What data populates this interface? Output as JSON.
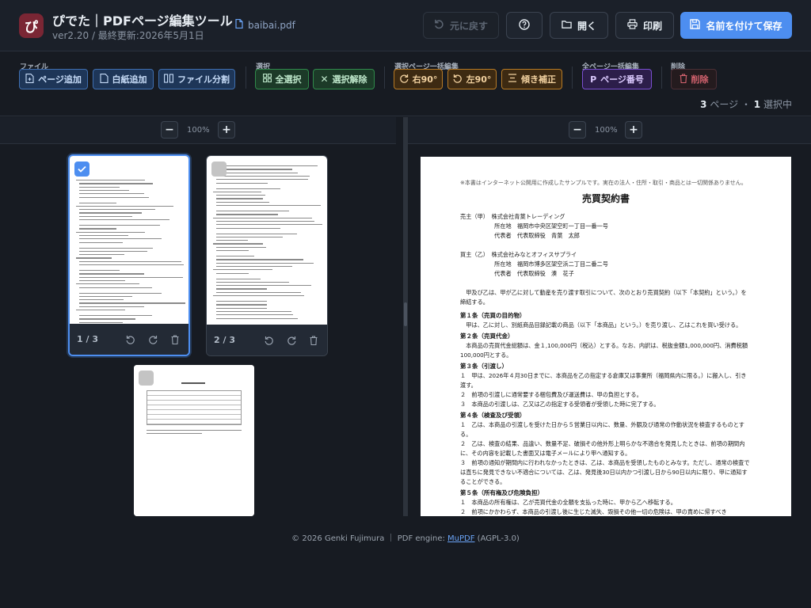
{
  "app": {
    "logo_char": "ぴ",
    "title": "ぴでた｜PDFページ編集ツール",
    "version": "ver2.20 / 最終更新:2026年5月1日",
    "file_name": "baibai.pdf"
  },
  "header_buttons": {
    "undo": "元に戻す",
    "help": "",
    "open": "開く",
    "print": "印刷",
    "save": "名前を付けて保存"
  },
  "toolbar": {
    "groups": {
      "file": "ファイル",
      "select": "選択",
      "sel_batch": "選択ページ一括編集",
      "all_batch": "全ページ一括編集",
      "delete": "削除"
    },
    "add_page": "ページ追加",
    "add_blank": "白紙追加",
    "split_file": "ファイル分割",
    "select_all": "全選択",
    "deselect": "選択解除",
    "rotate_right": "右90°",
    "rotate_left": "左90°",
    "deskew": "傾き補正",
    "page_number": "ページ番号",
    "delete": "削除"
  },
  "status": {
    "pages": "3",
    "pages_label": "ページ",
    "dot": "・",
    "selected": "1",
    "selected_label": "選択中"
  },
  "zoom": {
    "left": "100%",
    "right": "100%",
    "minus": "−",
    "plus": "+"
  },
  "thumbnails": [
    {
      "label": "1 / 3",
      "selected": true
    },
    {
      "label": "2 / 3",
      "selected": false
    },
    {
      "label": "3 / 3",
      "selected": false
    }
  ],
  "preview": {
    "note": "※本書はインターネット公開用に作成したサンプルです。実在の法人・住所・取引・商品とは一切関係ありません。",
    "title": "売買契約書",
    "seller": "売主（甲）　株式会社青葉トレーディング\n　　　　　　所在地　福岡市中央区架空町一丁目一番一号\n　　　　　　代表者　代表取締役　青葉　太郎",
    "buyer": "買主（乙）　株式会社みなとオフィスサプライ\n　　　　　　所在地　福岡市博多区架空浜二丁目二番二号\n　　　　　　代表者　代表取締役　湊　花子",
    "intro": "　甲及び乙は、甲が乙に対して動産を売り渡す取引について、次のとおり売買契約（以下「本契約」という。）を締結する。",
    "a1_title": "第１条（売買の目的物）",
    "a1_body": "　甲は、乙に対し、別紙商品目録記載の商品（以下「本商品」という。）を売り渡し、乙はこれを買い受ける。",
    "a2_title": "第２条（売買代金）",
    "a2_body": "　本商品の売買代金総額は、金１,100,000円（税込）とする。なお、内訳は、税抜金額1,000,000円、消費税額100,000円とする。",
    "a3_title": "第３条（引渡し）",
    "a3_b1": "１　甲は、2026年４月30日までに、本商品を乙の指定する倉庫又は事業所（福岡県内に限る。）に搬入し、引き渡す。",
    "a3_b2": "２　前項の引渡しに通常要する梱包費及び運送費は、甲の負担とする。",
    "a3_b3": "３　本商品の引渡しは、乙又は乙の指定する受領者が受領した時に完了する。",
    "a4_title": "第４条（検査及び受領）",
    "a4_b1": "１　乙は、本商品の引渡しを受けた日から５営業日以内に、数量、外観及び通常の作動状況を検査するものとする。",
    "a4_b2": "２　乙は、検査の結果、品違い、数量不足、破損その他外形上明らかな不適合を発見したときは、前項の期間内に、その内容を記載した書面又は電子メールにより甲へ通知する。",
    "a4_b3": "３　前項の通知が期間内に行われなかったときは、乙は、本商品を受領したものとみなす。ただし、通常の検査では直ちに発見できない不適合については、乙は、発見後30日以内かつ引渡し日から90日以内に限り、甲に通知することができる。",
    "a5_title": "第５条（所有権及び危険負担）",
    "a5_b1": "１　本商品の所有権は、乙が売買代金の全額を支払った時に、甲から乙へ移転する。",
    "a5_b2": "２　前項にかかわらず、本商品の引渡し後に生じた滅失、毀損その他一切の危険は、甲の責めに帰すべき"
  },
  "footer": {
    "copyright": "© 2026 Genki Fujimura ｜ PDF engine: ",
    "engine_link": "MuPDF",
    "license": " (AGPL-3.0)"
  },
  "colors": {
    "accent": "#4d8ef0",
    "logo_bg": "#7a2634",
    "background": "#171b22"
  }
}
